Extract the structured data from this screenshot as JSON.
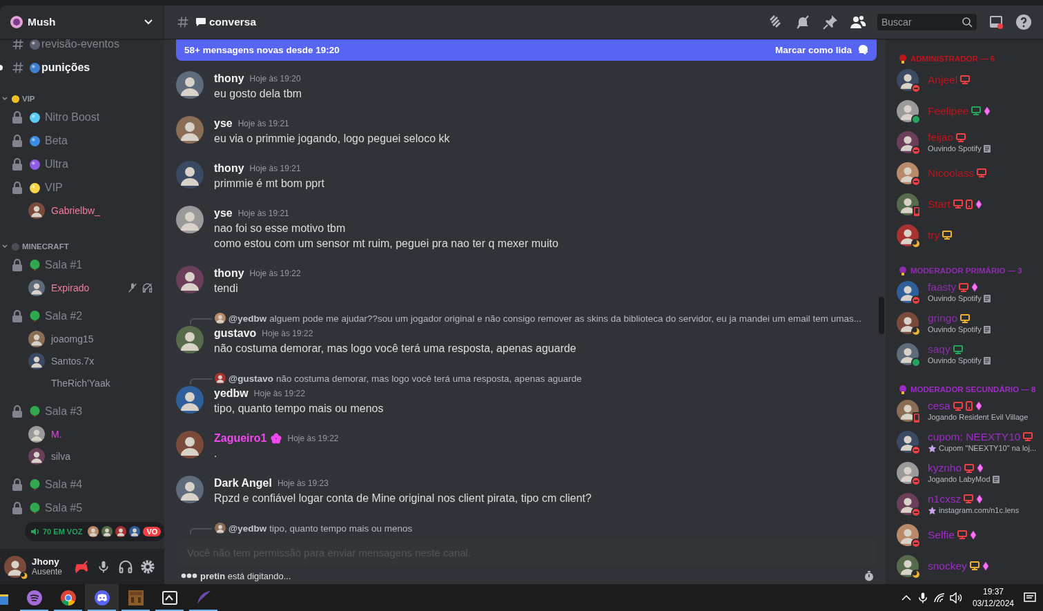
{
  "server": {
    "name": "Mush"
  },
  "sidebar": {
    "channels": [
      {
        "name": "revisão-eventos",
        "unread": false,
        "color": "#5b6070"
      },
      {
        "name": "punições",
        "unread": true,
        "color": "#3f7fd0"
      }
    ],
    "categories": [
      {
        "name": "VIP",
        "expanded": true,
        "color": "#f0c020",
        "channels": [
          {
            "kind": "locked",
            "name": "Nitro Boost",
            "color": "#5bcaf5"
          },
          {
            "kind": "locked",
            "name": "Beta",
            "color": "#3a8ee6"
          },
          {
            "kind": "locked",
            "name": "Ultra",
            "color": "#8e5ce6"
          },
          {
            "kind": "locked",
            "name": "VIP",
            "color": "#f5d547",
            "users": [
              {
                "name": "Gabrielbw_",
                "color": "#f47b9c",
                "avatar": true,
                "muted": false,
                "deafened": false
              }
            ]
          }
        ]
      },
      {
        "name": "MINECRAFT",
        "expanded": true,
        "color": "#4a4d55",
        "channels": [
          {
            "kind": "room",
            "name": "Sala #1",
            "color": "#2fa84f",
            "users": [
              {
                "name": "Expirado",
                "color": "#f47b9c",
                "avatar": true,
                "muted": true,
                "deafened": true
              }
            ]
          },
          {
            "kind": "room",
            "name": "Sala #2",
            "color": "#2fa84f",
            "users": [
              {
                "name": "joaomg15",
                "color": "#949ba4",
                "avatar": true,
                "muted": false,
                "deafened": false
              },
              {
                "name": "Santos.7x",
                "color": "#949ba4",
                "avatar": true,
                "muted": false,
                "deafened": false
              },
              {
                "name": "TheRich'Yaak",
                "color": "#949ba4",
                "avatar": false,
                "muted": false,
                "deafened": false
              }
            ]
          },
          {
            "kind": "room",
            "name": "Sala #3",
            "color": "#2fa84f",
            "users": [
              {
                "name": "M.",
                "color": "#e93fe9",
                "avatar": true,
                "muted": false,
                "deafened": false
              },
              {
                "name": "silva",
                "color": "#949ba4",
                "avatar": true,
                "muted": false,
                "deafened": false
              }
            ]
          },
          {
            "kind": "room",
            "name": "Sala #4",
            "color": "#2fa84f"
          },
          {
            "kind": "room",
            "name": "Sala #5",
            "color": "#2fa84f"
          }
        ]
      }
    ],
    "voice_banner": {
      "label": "70 EM VOZ",
      "live": "VO"
    }
  },
  "user_panel": {
    "name": "Jhony",
    "status_text": "Ausente",
    "kind": "idle"
  },
  "header": {
    "channel": "conversa",
    "search": {
      "placeholder": "Buscar"
    }
  },
  "chat": {
    "banner": {
      "text": "58+ mensagens novas desde 19:20",
      "action": "Marcar como lida"
    },
    "messages": [
      {
        "author": "thony",
        "color": "#f2f3f5",
        "badge": false,
        "time": "Hoje às 19:20",
        "lines": [
          "eu gosto dela tbm"
        ]
      },
      {
        "author": "yse",
        "color": "#f2f3f5",
        "badge": false,
        "time": "Hoje às 19:21",
        "lines": [
          "eu via o primmie jogando, logo peguei seloco kk"
        ]
      },
      {
        "author": "thony",
        "color": "#f2f3f5",
        "badge": false,
        "time": "Hoje às 19:21",
        "lines": [
          "primmie é mt bom pprt"
        ]
      },
      {
        "author": "yse",
        "color": "#f2f3f5",
        "badge": false,
        "time": "Hoje às 19:21",
        "lines": [
          "nao foi so esse motivo tbm",
          "como estou com um sensor mt ruim, peguei pra nao ter q mexer muito"
        ]
      },
      {
        "author": "thony",
        "color": "#f2f3f5",
        "badge": false,
        "time": "Hoje às 19:22",
        "lines": [
          "tendi"
        ]
      },
      {
        "reply": {
          "author": "@yedbw",
          "text": "alguem pode me ajudar??sou um jogador original e não consigo remover as skins da biblioteca do servidor, eu ja mandei um email tem umas..."
        },
        "author": "gustavo",
        "color": "#f2f3f5",
        "badge": false,
        "time": "Hoje às 19:22",
        "lines": [
          "não costuma demorar, mas logo você terá uma resposta, apenas aguarde"
        ]
      },
      {
        "reply": {
          "author": "@gustavo",
          "text": "não costuma demorar, mas logo você terá uma resposta, apenas aguarde"
        },
        "author": "yedbw",
        "color": "#f2f3f5",
        "badge": false,
        "time": "Hoje às 19:22",
        "lines": [
          "tipo, quanto tempo mais ou menos"
        ]
      },
      {
        "author": "Zagueiro1",
        "color": "#f047f0",
        "badge": true,
        "time": "Hoje às 19:22",
        "lines": [
          "."
        ]
      },
      {
        "author": "Dark Angel",
        "color": "#f2f3f5",
        "badge": false,
        "time": "Hoje às 19:23",
        "lines": [
          "Rpzd e confiável logar conta de Mine original nos client pirata, tipo cm client?"
        ]
      },
      {
        "reply": {
          "author": "@yedbw",
          "text": "tipo, quanto tempo mais ou menos"
        }
      }
    ],
    "input": {
      "placeholder": "Você não tem permissão para enviar mensagens neste canal.",
      "disabled": true
    },
    "typing": "**pretin** está digitando..."
  },
  "members": [
    {
      "title": "ADMINISTRADOR — 6",
      "color": "#c0141b",
      "users": [
        {
          "name": "Anjeel",
          "kind": "dnd",
          "boost": false,
          "platforms": [
            {
              "kind": "desktop",
              "color": "#f23f43"
            }
          ]
        },
        {
          "name": "Feelipee",
          "kind": "online",
          "boost": true,
          "platforms": [
            {
              "kind": "desktop",
              "color": "#23a55a"
            }
          ]
        },
        {
          "name": "feijao",
          "kind": "dnd",
          "boost": false,
          "platforms": [
            {
              "kind": "desktop",
              "color": "#f23f43"
            }
          ],
          "activity": "Ouvindo Spotify",
          "rich_presence": true,
          "activity_icon": false
        },
        {
          "name": "Nicoolass",
          "kind": "dnd",
          "boost": false,
          "platforms": [
            {
              "kind": "desktop",
              "color": "#f23f43"
            }
          ]
        },
        {
          "name": "Start",
          "kind": "mobile",
          "boost": true,
          "platforms": [
            {
              "kind": "desktop",
              "color": "#f23f43"
            },
            {
              "kind": "mobile",
              "color": "#f23f43"
            }
          ]
        },
        {
          "name": "try",
          "kind": "idle",
          "boost": false,
          "platforms": [
            {
              "kind": "desktop",
              "color": "#f0b232"
            }
          ]
        }
      ]
    },
    {
      "title": "MODERADOR PRIMÁRIO — 3",
      "color": "#8e2cad",
      "users": [
        {
          "name": "faasty",
          "kind": "dnd",
          "boost": true,
          "platforms": [
            {
              "kind": "desktop",
              "color": "#f23f43"
            }
          ],
          "activity": "Ouvindo Spotify",
          "rich_presence": true,
          "activity_icon": false
        },
        {
          "name": "gringo",
          "kind": "idle",
          "boost": false,
          "platforms": [
            {
              "kind": "desktop",
              "color": "#f0b232"
            }
          ],
          "activity": "Ouvindo Spotify",
          "rich_presence": true,
          "activity_icon": false
        },
        {
          "name": "saqy",
          "kind": "online",
          "boost": false,
          "platforms": [
            {
              "kind": "desktop",
              "color": "#23a55a"
            }
          ],
          "activity": "Ouvindo Spotify",
          "rich_presence": true,
          "activity_icon": false
        }
      ]
    },
    {
      "title": "MODERADOR SECUNDÁRIO — 8",
      "color": "#a02bc8",
      "users": [
        {
          "name": "cesa",
          "kind": "mobile",
          "boost": true,
          "platforms": [
            {
              "kind": "desktop",
              "color": "#f23f43"
            },
            {
              "kind": "mobile",
              "color": "#f23f43"
            }
          ],
          "activity": "Jogando Resident Evil Village",
          "rich_presence": false,
          "activity_icon": false
        },
        {
          "name": "cupom: NEEXTY10",
          "kind": "dnd",
          "boost": false,
          "platforms": [
            {
              "kind": "desktop",
              "color": "#f23f43"
            }
          ],
          "activity": "Cupom \"NEEXTY10\" na loj...",
          "rich_presence": false,
          "activity_icon": true
        },
        {
          "name": "kyznho",
          "kind": "dnd",
          "boost": true,
          "platforms": [
            {
              "kind": "desktop",
              "color": "#f23f43"
            }
          ],
          "activity": "Jogando LabyMod",
          "rich_presence": true,
          "activity_icon": false
        },
        {
          "name": "n1cxsz",
          "kind": "dnd",
          "boost": true,
          "platforms": [
            {
              "kind": "desktop",
              "color": "#f23f43"
            }
          ],
          "activity": "instagram.com/n1c.lens",
          "rich_presence": false,
          "activity_icon": true
        },
        {
          "name": "Selfie",
          "kind": "dnd",
          "boost": true,
          "platforms": [
            {
              "kind": "desktop",
              "color": "#f23f43"
            }
          ]
        },
        {
          "name": "snockey",
          "kind": "idle",
          "boost": true,
          "platforms": [
            {
              "kind": "desktop",
              "color": "#f0b232"
            }
          ]
        }
      ]
    }
  ],
  "taskbar": {
    "apps": [
      {
        "kind": "folder",
        "running": false,
        "selected": false
      },
      {
        "kind": "music",
        "running": true,
        "selected": false
      },
      {
        "kind": "browser",
        "running": true,
        "selected": false
      },
      {
        "kind": "chat",
        "running": true,
        "selected": true
      },
      {
        "kind": "block",
        "running": true,
        "selected": false
      },
      {
        "kind": "terminal",
        "running": true,
        "selected": false
      },
      {
        "kind": "feather",
        "running": true,
        "selected": false
      }
    ],
    "time": "19:37",
    "date": "03/12/2024"
  }
}
